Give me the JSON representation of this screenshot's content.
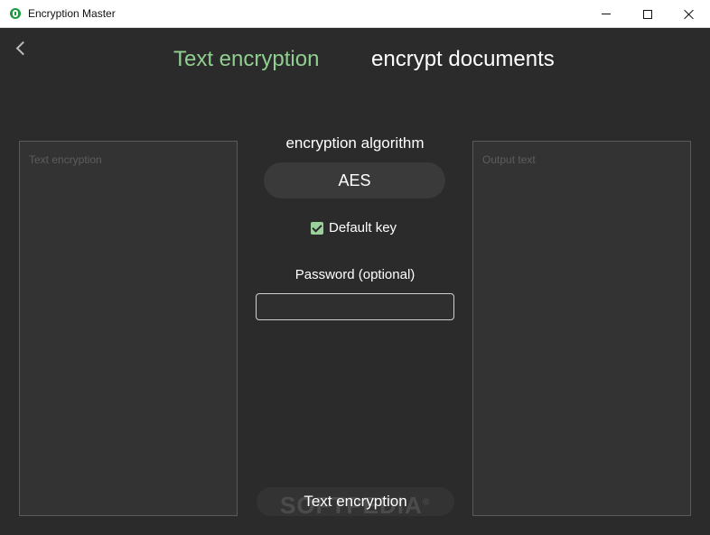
{
  "window": {
    "title": "Encryption Master",
    "icon": "lock-icon",
    "controls": {
      "minimize": "minimize-icon",
      "maximize": "maximize-icon",
      "close": "close-icon"
    }
  },
  "nav": {
    "back_icon": "chevron-left-icon"
  },
  "tabs": [
    {
      "label": "Text encryption",
      "active": true,
      "color": "#8fcf8f"
    },
    {
      "label": "encrypt documents",
      "active": false,
      "color": "#ffffff"
    }
  ],
  "input_panel": {
    "placeholder": "Text encryption",
    "value": ""
  },
  "output_panel": {
    "placeholder": "Output text",
    "value": ""
  },
  "algorithm": {
    "label": "encryption algorithm",
    "selected": "AES"
  },
  "default_key": {
    "label": "Default key",
    "checked": true
  },
  "password": {
    "label": "Password (optional)",
    "value": ""
  },
  "action": {
    "label": "Text encryption"
  },
  "watermark": {
    "text": "SOFTPEDIA",
    "mark": "®"
  },
  "colors": {
    "background": "#2b2b2b",
    "accent": "#8fcf8f",
    "panel": "#333333"
  }
}
